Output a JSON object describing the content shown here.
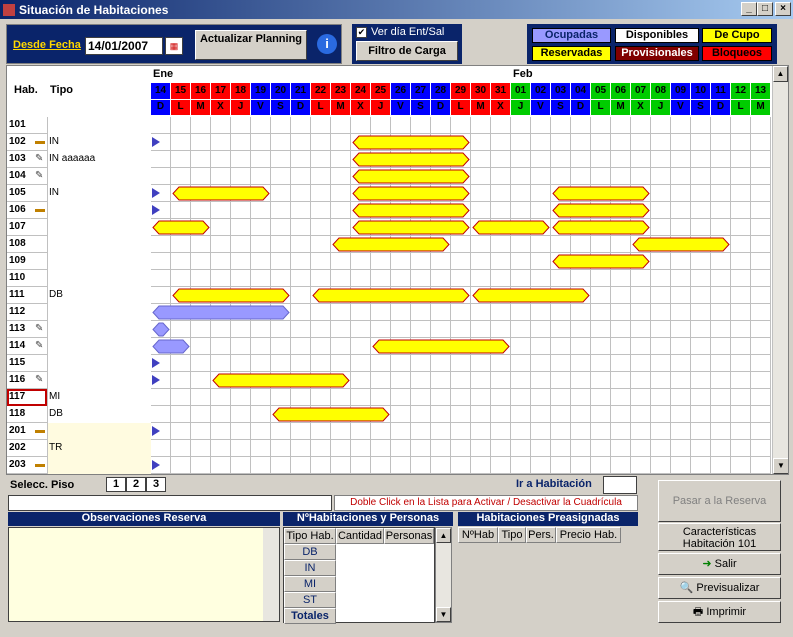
{
  "window": {
    "title": "Situación de Habitaciones",
    "min": "_",
    "max": "□",
    "close": "×"
  },
  "toolbar": {
    "date_label": "Desde Fecha",
    "date_value": "14/01/2007",
    "refresh_label": "Actualizar Planning",
    "info": "i",
    "checkbox_label": "Ver día Ent/Sal",
    "checkbox_checked": "✔",
    "filter_label": "Filtro de Carga"
  },
  "legend": {
    "ocupadas": "Ocupadas",
    "disponibles": "Disponibles",
    "de_cupo": "De Cupo",
    "reservadas": "Reservadas",
    "provisionales": "Provisionales",
    "bloqueos": "Bloqueos"
  },
  "grid": {
    "hab_header": "Hab.",
    "tipo_header": "Tipo",
    "month1": "Ene",
    "month2": "Feb",
    "days": [
      {
        "n": "14",
        "d": "D",
        "c": "#0000ff"
      },
      {
        "n": "15",
        "d": "L",
        "c": "#ff0000"
      },
      {
        "n": "16",
        "d": "M",
        "c": "#ff0000"
      },
      {
        "n": "17",
        "d": "X",
        "c": "#ff0000"
      },
      {
        "n": "18",
        "d": "J",
        "c": "#ff0000"
      },
      {
        "n": "19",
        "d": "V",
        "c": "#0000ff"
      },
      {
        "n": "20",
        "d": "S",
        "c": "#0000ff"
      },
      {
        "n": "21",
        "d": "D",
        "c": "#0000ff"
      },
      {
        "n": "22",
        "d": "L",
        "c": "#ff0000"
      },
      {
        "n": "23",
        "d": "M",
        "c": "#ff0000"
      },
      {
        "n": "24",
        "d": "X",
        "c": "#ff0000"
      },
      {
        "n": "25",
        "d": "J",
        "c": "#ff0000"
      },
      {
        "n": "26",
        "d": "V",
        "c": "#0000ff"
      },
      {
        "n": "27",
        "d": "S",
        "c": "#0000ff"
      },
      {
        "n": "28",
        "d": "D",
        "c": "#0000ff"
      },
      {
        "n": "29",
        "d": "L",
        "c": "#ff0000"
      },
      {
        "n": "30",
        "d": "M",
        "c": "#ff0000"
      },
      {
        "n": "31",
        "d": "X",
        "c": "#ff0000"
      },
      {
        "n": "01",
        "d": "J",
        "c": "#00cc00"
      },
      {
        "n": "02",
        "d": "V",
        "c": "#0000ff"
      },
      {
        "n": "03",
        "d": "S",
        "c": "#0000ff"
      },
      {
        "n": "04",
        "d": "D",
        "c": "#0000ff"
      },
      {
        "n": "05",
        "d": "L",
        "c": "#00cc00"
      },
      {
        "n": "06",
        "d": "M",
        "c": "#00cc00"
      },
      {
        "n": "07",
        "d": "X",
        "c": "#00cc00"
      },
      {
        "n": "08",
        "d": "J",
        "c": "#00cc00"
      },
      {
        "n": "09",
        "d": "V",
        "c": "#0000ff"
      },
      {
        "n": "10",
        "d": "S",
        "c": "#0000ff"
      },
      {
        "n": "11",
        "d": "D",
        "c": "#0000ff"
      },
      {
        "n": "12",
        "d": "L",
        "c": "#00cc00"
      },
      {
        "n": "13",
        "d": "M",
        "c": "#00cc00"
      }
    ],
    "rooms": [
      {
        "n": "101",
        "icon": ""
      },
      {
        "n": "102",
        "icon": "bed"
      },
      {
        "n": "103",
        "icon": "broom"
      },
      {
        "n": "104",
        "icon": "broom"
      },
      {
        "n": "105",
        "icon": ""
      },
      {
        "n": "106",
        "icon": "bed"
      },
      {
        "n": "107",
        "icon": ""
      },
      {
        "n": "108",
        "icon": ""
      },
      {
        "n": "109",
        "icon": ""
      },
      {
        "n": "110",
        "icon": ""
      },
      {
        "n": "111",
        "icon": ""
      },
      {
        "n": "112",
        "icon": ""
      },
      {
        "n": "113",
        "icon": "broom"
      },
      {
        "n": "114",
        "icon": "broom"
      },
      {
        "n": "115",
        "icon": ""
      },
      {
        "n": "116",
        "icon": "broom"
      },
      {
        "n": "117",
        "icon": ""
      },
      {
        "n": "118",
        "icon": ""
      },
      {
        "n": "201",
        "icon": "bed"
      },
      {
        "n": "202",
        "icon": ""
      },
      {
        "n": "203",
        "icon": "bed"
      }
    ],
    "types": [
      {
        "label": "IN",
        "row": 1
      },
      {
        "label": "IN aaaaaa",
        "row": 2
      },
      {
        "label": "IN",
        "row": 4
      },
      {
        "label": "DB",
        "row": 10
      },
      {
        "label": "MI",
        "row": 16
      },
      {
        "label": "DB",
        "row": 17
      },
      {
        "label": "TR",
        "row": 19
      }
    ],
    "bars": [
      {
        "row": 1,
        "s": 10,
        "e": 16,
        "t": "y"
      },
      {
        "row": 2,
        "s": 10,
        "e": 16,
        "t": "y"
      },
      {
        "row": 3,
        "s": 10,
        "e": 16,
        "t": "y"
      },
      {
        "row": 4,
        "s": 10,
        "e": 16,
        "t": "y"
      },
      {
        "row": 4,
        "s": 1,
        "e": 6,
        "t": "y"
      },
      {
        "row": 4,
        "s": 20,
        "e": 25,
        "t": "y"
      },
      {
        "row": 5,
        "s": 10,
        "e": 16,
        "t": "y"
      },
      {
        "row": 5,
        "s": 20,
        "e": 25,
        "t": "y"
      },
      {
        "row": 6,
        "s": 0,
        "e": 3,
        "t": "y"
      },
      {
        "row": 6,
        "s": 10,
        "e": 16,
        "t": "y"
      },
      {
        "row": 6,
        "s": 16,
        "e": 20,
        "t": "y"
      },
      {
        "row": 6,
        "s": 20,
        "e": 25,
        "t": "y"
      },
      {
        "row": 7,
        "s": 9,
        "e": 15,
        "t": "y"
      },
      {
        "row": 7,
        "s": 24,
        "e": 29,
        "t": "y"
      },
      {
        "row": 8,
        "s": 20,
        "e": 25,
        "t": "y"
      },
      {
        "row": 10,
        "s": 1,
        "e": 7,
        "t": "y"
      },
      {
        "row": 10,
        "s": 8,
        "e": 16,
        "t": "y"
      },
      {
        "row": 10,
        "s": 16,
        "e": 22,
        "t": "y"
      },
      {
        "row": 11,
        "s": 0,
        "e": 7,
        "t": "b"
      },
      {
        "row": 12,
        "s": 0,
        "e": 1,
        "t": "b"
      },
      {
        "row": 13,
        "s": 0,
        "e": 2,
        "t": "b"
      },
      {
        "row": 13,
        "s": 11,
        "e": 18,
        "t": "y"
      },
      {
        "row": 15,
        "s": 3,
        "e": 10,
        "t": "y"
      },
      {
        "row": 17,
        "s": 6,
        "e": 12,
        "t": "y"
      }
    ],
    "arrows": [
      1,
      4,
      5,
      14,
      15,
      18,
      20
    ]
  },
  "bottom": {
    "piso_label": "Selecc. Piso",
    "pisos": [
      "1",
      "2",
      "3"
    ],
    "ir_label": "Ir a Habitación",
    "hint": "Doble Click en la Lista para Activar / Desactivar la Cuadrícula",
    "obs_title": "Observaciones Reserva",
    "num_title": "NºHabitaciones y Personas",
    "num_cols": [
      "Tipo Hab.",
      "Cantidad",
      "Personas"
    ],
    "num_rows": [
      "DB",
      "IN",
      "MI",
      "ST"
    ],
    "totales": "Totales",
    "pre_title": "Habitaciones Preasignadas",
    "pre_cols": [
      "NºHab",
      "Tipo",
      "Pers.",
      "Precio Hab."
    ],
    "pasar": "Pasar a la Reserva",
    "caract": "Características Habitación 101",
    "salir": "Salir",
    "previs": "Previsualizar",
    "imprimir": "Imprimir"
  },
  "colors": {
    "reservada": "#ffff00",
    "ocupada": "#9999ff",
    "blue": "#0a246a"
  }
}
